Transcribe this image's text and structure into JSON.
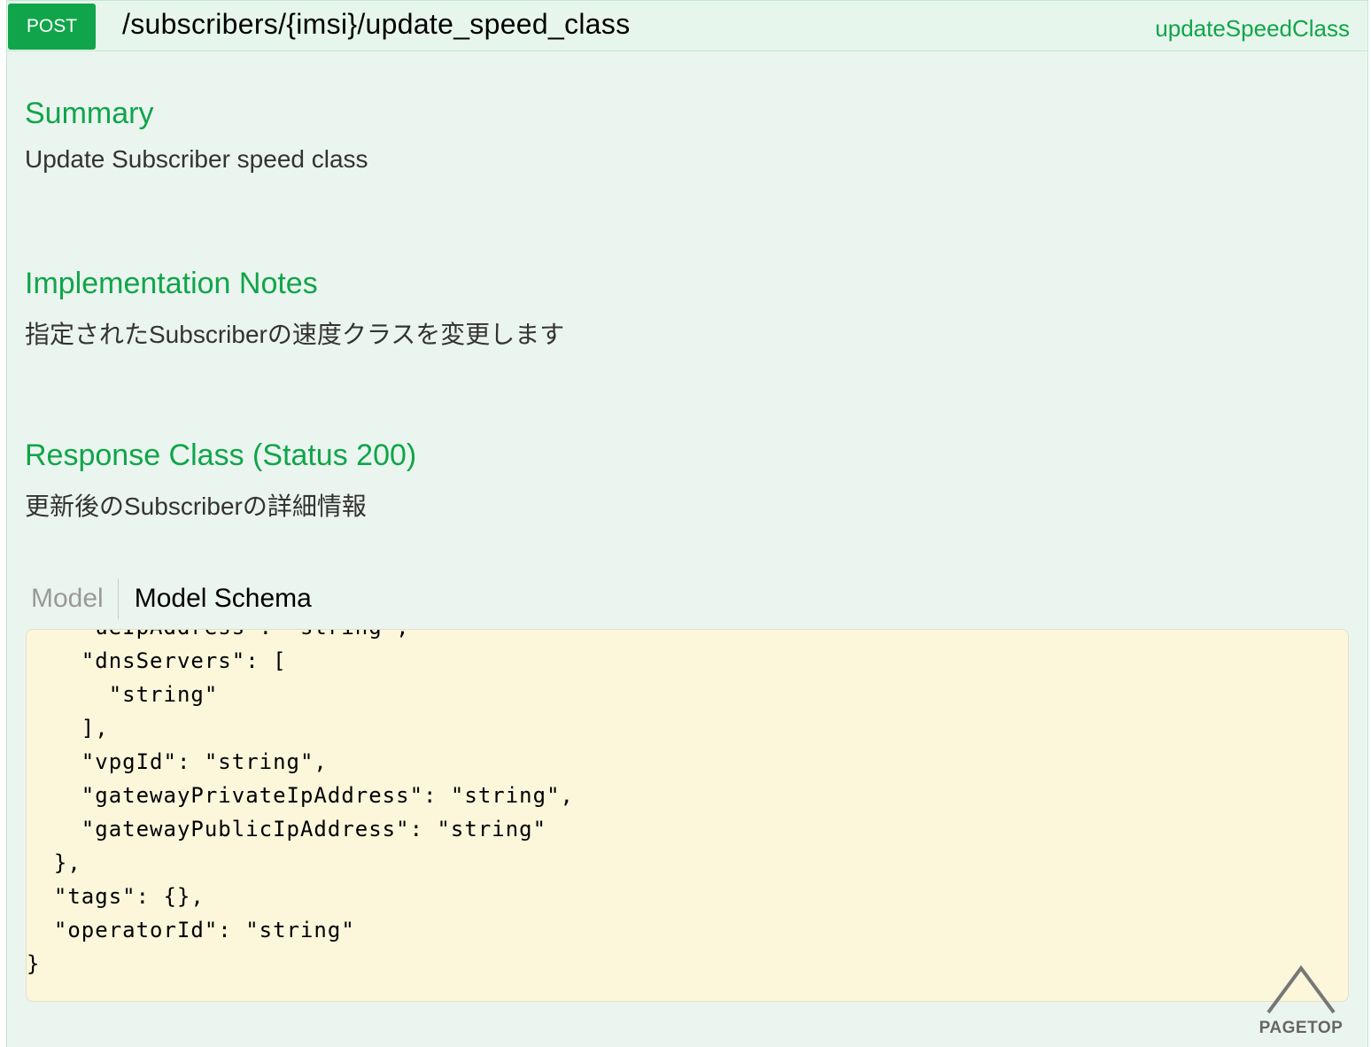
{
  "endpoint": {
    "method": "POST",
    "path": "/subscribers/{imsi}/update_speed_class",
    "nickname": "updateSpeedClass"
  },
  "summary": {
    "title": "Summary",
    "text": "Update Subscriber speed class"
  },
  "implementation_notes": {
    "title": "Implementation Notes",
    "text": "指定されたSubscriberの速度クラスを変更します"
  },
  "response_class": {
    "title": "Response Class (Status 200)",
    "text": "更新後のSubscriberの詳細情報"
  },
  "tabs": {
    "model": "Model",
    "model_schema": "Model Schema"
  },
  "code_lines": [
    "    \"ueIpAddress\": \"string\",",
    "    \"dnsServers\": [",
    "      \"string\"",
    "    ],",
    "    \"vpgId\": \"string\",",
    "    \"gatewayPrivateIpAddress\": \"string\",",
    "    \"gatewayPublicIpAddress\": \"string\"",
    "  },",
    "  \"tags\": {},",
    "  \"operatorId\": \"string\"",
    "}"
  ],
  "pagetop": {
    "label": "PAGETOP",
    "icon": "caret-up-icon"
  },
  "colors": {
    "accent": "#10a54a",
    "panel_bg": "#ebf5ef",
    "code_bg": "#fcf6db"
  }
}
